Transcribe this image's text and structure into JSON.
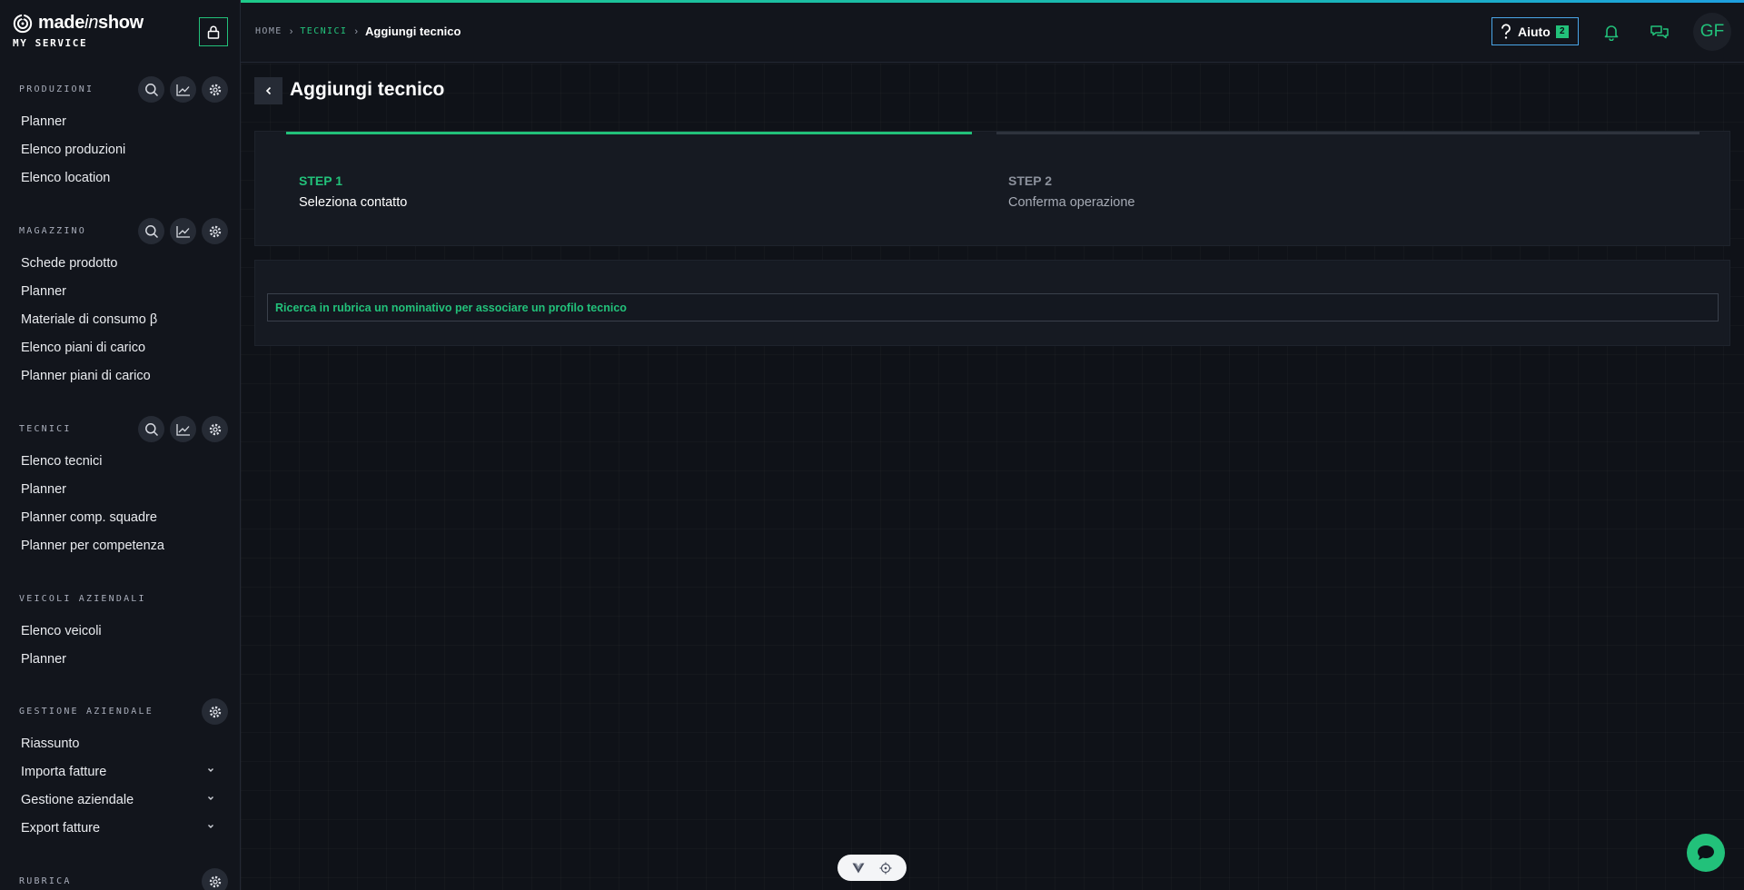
{
  "brand": {
    "name_prefix": "made",
    "name_italic": "in",
    "name_suffix": "show",
    "subtitle": "MY SERVICE"
  },
  "sidebar": {
    "sections": [
      {
        "title": "PRODUZIONI",
        "items": [
          "Planner",
          "Elenco produzioni",
          "Elenco location"
        ]
      },
      {
        "title": "MAGAZZINO",
        "items": [
          "Schede prodotto",
          "Planner",
          "Materiale di consumo β",
          "Elenco piani di carico",
          "Planner piani di carico"
        ]
      },
      {
        "title": "TECNICI",
        "items": [
          "Elenco tecnici",
          "Planner",
          "Planner comp. squadre",
          "Planner per competenza"
        ]
      },
      {
        "title": "VEICOLI AZIENDALI",
        "items": [
          "Elenco veicoli",
          "Planner"
        ]
      },
      {
        "title": "GESTIONE AZIENDALE",
        "items": [
          "Riassunto",
          "Importa fatture",
          "Gestione aziendale",
          "Export fatture"
        ]
      },
      {
        "title": "RUBRICA",
        "items": []
      }
    ]
  },
  "topbar": {
    "breadcrumb": {
      "home": "HOME",
      "section": "TECNICI",
      "current": "Aggiungi tecnico"
    },
    "help_label": "Aiuto",
    "help_badge": "2",
    "avatar_initials": "GF"
  },
  "main": {
    "title": "Aggiungi tecnico",
    "steps": [
      {
        "label": "STEP 1",
        "desc": "Seleziona contatto",
        "active": true
      },
      {
        "label": "STEP 2",
        "desc": "Conferma operazione",
        "active": false
      }
    ],
    "search_prompt": "Ricerca in rubrica un nominativo per associare un profilo tecnico"
  },
  "colors": {
    "accent": "#22c17a",
    "help_border": "#4aa6e8",
    "background": "#0f1218",
    "sidebar": "#12151c"
  },
  "icons": {
    "lock": "lock-icon",
    "search": "search-icon",
    "stats": "chart-line-icon",
    "settings": "gear-icon",
    "help": "question-icon",
    "bell": "bell-icon",
    "chat": "chat-bubbles-icon",
    "back": "chevron-left-icon",
    "expand": "chevron-down-icon"
  }
}
